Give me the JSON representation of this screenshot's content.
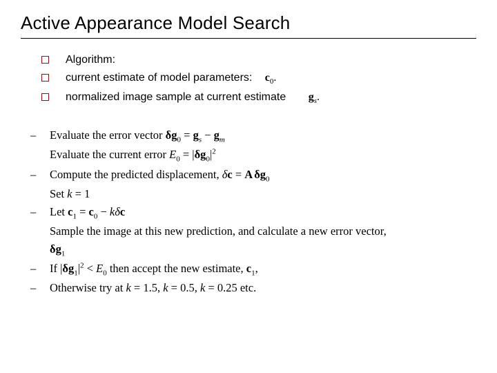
{
  "title": "Active Appearance Model Search",
  "bullets": {
    "b0": "Algorithm:",
    "b1": "current estimate of model parameters:",
    "b1_sym_main": "c",
    "b1_sym_sub": "0",
    "b2": "normalized image sample at current estimate",
    "b2_sym_main": "g",
    "b2_sym_sub": "s"
  },
  "algo": {
    "l0_a": "Evaluate the error vector ",
    "l0_dg0": "δg",
    "l0_sub0": "0",
    "l0_eq": " = ",
    "l0_gs": "g",
    "l0_subs": "s",
    "l0_minus": " − ",
    "l0_gm": "g",
    "l0_subm": "m",
    "l1_a": "Evaluate the current error ",
    "l1_E0": "E",
    "l1_E0sub": "0",
    "l1_eq": " = |",
    "l1_dg0": "δg",
    "l1_dg0sub": "0",
    "l1_close": "|",
    "l1_sq": "2",
    "l2_a": "Compute the predicted displacement, ",
    "l2_dc": "δc",
    "l2_eq": " = ",
    "l2_A": "A",
    "l2_dg0": "δg",
    "l2_dg0sub": "0",
    "l3_a": "Set ",
    "l3_k": "k",
    "l3_eq": " = 1",
    "l4_a": "Let ",
    "l4_c1": "c",
    "l4_c1sub": "1",
    "l4_eq": " = ",
    "l4_c0": "c",
    "l4_c0sub": "0",
    "l4_minus": " − ",
    "l4_k": "k",
    "l4_dc": "δc",
    "l5_a": "Sample the image at this new prediction, and calculate a new error vector,",
    "l5_dg1": "δg",
    "l5_dg1sub": "1",
    "l6_a": "If |",
    "l6_dg1": "δg",
    "l6_dg1sub": "1",
    "l6_pipe": "|",
    "l6_sq": "2",
    "l6_lt": " < ",
    "l6_E0": "E",
    "l6_E0sub": "0",
    "l6_b": " then accept the new estimate, ",
    "l6_c1": "c",
    "l6_c1sub": "1",
    "l6_c": ",",
    "l7_a": "Otherwise try at ",
    "l7_k": "k",
    "l7_b": " = 1.5, ",
    "l7_k2": "k",
    "l7_c": " = 0.5, ",
    "l7_k3": "k",
    "l7_d": " = 0.25 etc."
  }
}
